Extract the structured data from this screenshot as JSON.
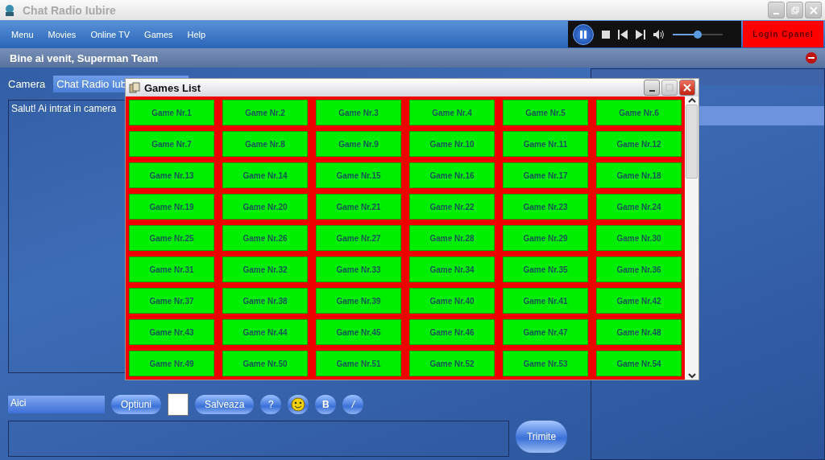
{
  "window": {
    "title": "Chat Radio Iubire"
  },
  "menu": [
    "Menu",
    "Movies",
    "Online TV",
    "Games",
    "Help"
  ],
  "player": {
    "playing": true,
    "volume": {
      "level": 0.5
    }
  },
  "login_button": "Login Cpanel",
  "welcome": "Bine ai venit, Superman Team",
  "camera": {
    "label": "Camera",
    "value": "Chat Radio Iub"
  },
  "chat": {
    "message": "Salut! Ai intrat in camera"
  },
  "toolbar": {
    "font_select": "Aici",
    "options_button": "Optiuni",
    "save_button": "Salveaza",
    "help_button": "?",
    "bold_button": "B",
    "italic_button": "/"
  },
  "send_button": "Trimite",
  "games_dialog": {
    "title": "Games List",
    "games": [
      "Game Nr.1",
      "Game Nr.2",
      "Game Nr.3",
      "Game Nr.4",
      "Game Nr.5",
      "Game Nr.6",
      "Game Nr.7",
      "Game Nr.8",
      "Game Nr.9",
      "Game Nr.10",
      "Game Nr.11",
      "Game Nr.12",
      "Game Nr.13",
      "Game Nr.14",
      "Game Nr.15",
      "Game Nr.16",
      "Game Nr.17",
      "Game Nr.18",
      "Game Nr.19",
      "Game Nr.20",
      "Game Nr.21",
      "Game Nr.22",
      "Game Nr.23",
      "Game Nr.24",
      "Game Nr.25",
      "Game Nr.26",
      "Game Nr.27",
      "Game Nr.28",
      "Game Nr.29",
      "Game Nr.30",
      "Game Nr.31",
      "Game Nr.32",
      "Game Nr.33",
      "Game Nr.34",
      "Game Nr.35",
      "Game Nr.36",
      "Game Nr.37",
      "Game Nr.38",
      "Game Nr.39",
      "Game Nr.40",
      "Game Nr.41",
      "Game Nr.42",
      "Game Nr.43",
      "Game Nr.44",
      "Game Nr.45",
      "Game Nr.46",
      "Game Nr.47",
      "Game Nr.48",
      "Game Nr.49",
      "Game Nr.50",
      "Game Nr.51",
      "Game Nr.52",
      "Game Nr.53",
      "Game Nr.54"
    ]
  }
}
